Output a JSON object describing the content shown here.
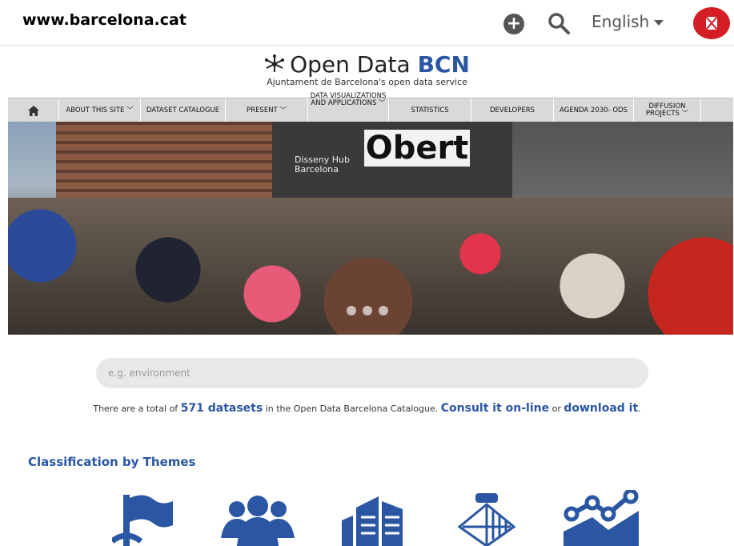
{
  "header": {
    "site": "www.barcelona.cat",
    "language": "English",
    "icons": [
      "plus-icon",
      "search-icon",
      "city-crest-icon"
    ]
  },
  "logo": {
    "title_prefix": "Open Data ",
    "title_bold": "BCN",
    "subtitle": "Ajuntament de Barcelona's open data service"
  },
  "nav": {
    "items": [
      {
        "label": "ABOUT THIS SITE ﹀"
      },
      {
        "label": "DATASET CATALOGUE"
      },
      {
        "label": "PRESENT ﹀"
      },
      {
        "label": "DATA VISUALIZATIONS AND APPLICATIONS ﹀"
      },
      {
        "label": "STATISTICS"
      },
      {
        "label": "DEVELOPERS"
      },
      {
        "label": "AGENDA 2030- ODS"
      },
      {
        "label": "DIFFUSION PROJECTS ﹀"
      }
    ]
  },
  "hero": {
    "sign_text": "Obert",
    "building_text": "Disseny Hub Barcelona",
    "slides": 3
  },
  "search": {
    "placeholder": "e.g. environment"
  },
  "catalogue": {
    "text_before": "There are a total of ",
    "count": "571 datasets",
    "text_middle": " in the Open Data Barcelona Catalogue. ",
    "consult": "Consult it on-line",
    "or": " or ",
    "download": "download it",
    "end": "."
  },
  "themes": {
    "title": "Classification by Themes",
    "icons": [
      "flag-icon",
      "people-icon",
      "building-icon",
      "coat-of-arms-icon",
      "trend-chart-icon"
    ]
  },
  "colors": {
    "brand_blue": "#2a56a3",
    "crest_red": "#d51d25",
    "nav_gray": "#d9d9d9"
  }
}
